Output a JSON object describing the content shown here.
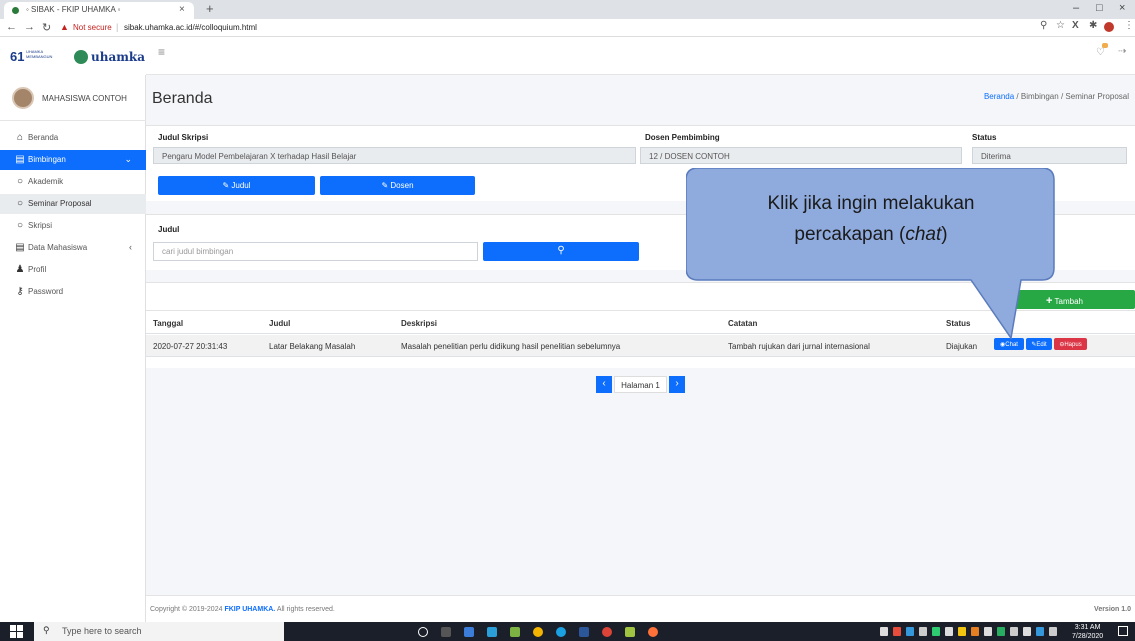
{
  "browser": {
    "tab_title": "◦ SIBAK - FKIP UHAMKA ◦",
    "tab_close": "×",
    "new_tab": "+",
    "not_secure": "Not secure",
    "url": "sibak.uhamka.ac.id/#/colloquium.html"
  },
  "brand": {
    "logo_text": "uhamka",
    "badge_text": "UHAMKA MEMBANGUN"
  },
  "sidebar": {
    "user_name": "MAHASISWA CONTOH",
    "items": [
      {
        "label": "Beranda",
        "icon": "home-icon"
      },
      {
        "label": "Bimbingan",
        "icon": "book-icon",
        "caret": "⌄"
      },
      {
        "label": "Akademik",
        "icon": "circle-icon"
      },
      {
        "label": "Seminar Proposal",
        "icon": "circle-icon"
      },
      {
        "label": "Skripsi",
        "icon": "circle-icon"
      },
      {
        "label": "Data Mahasiswa",
        "icon": "book-icon",
        "caret": "‹"
      },
      {
        "label": "Profil",
        "icon": "user-icon"
      },
      {
        "label": "Password",
        "icon": "key-icon"
      }
    ]
  },
  "page": {
    "title": "Beranda",
    "breadcrumb": [
      "Beranda",
      "Bimbingan",
      "Seminar Proposal"
    ],
    "breadcrumb_sep": "/"
  },
  "info": {
    "judul_label": "Judul Skripsi",
    "judul_value": "Pengaru Model Pembelajaran X terhadap Hasil Belajar",
    "dosen_label": "Dosen Pembimbing",
    "dosen_value": "12 / DOSEN CONTOH",
    "status_label": "Status",
    "status_value": "Diterima",
    "btn_judul": "Judul",
    "btn_dosen": "Dosen"
  },
  "search": {
    "label": "Judul",
    "placeholder": "cari judul bimbingan"
  },
  "table": {
    "add_button": "Tambah",
    "headers": [
      "Tanggal",
      "Judul",
      "Deskripsi",
      "Catatan",
      "Status"
    ],
    "rows": [
      {
        "tanggal": "2020-07-27 20:31:43",
        "judul": "Latar Belakang Masalah",
        "deskripsi": "Masalah penelitian perlu didikung hasil penelitian sebelumnya",
        "catatan": "Tambah rujukan dari jurnal internasional",
        "status": "Diajukan"
      }
    ],
    "actions": {
      "chat": "Chat",
      "edit": "Edit",
      "hapus": "Hapus"
    }
  },
  "pager": {
    "label": "Halaman 1"
  },
  "footer": {
    "copyright_prefix": "Copyright © 2019-2024",
    "org": "FKIP UHAMKA.",
    "suffix": "All rights reserved.",
    "version": "Version 1.0"
  },
  "callout": {
    "line1": "Klik jika ingin melakukan",
    "line2_prefix": "percakapan (",
    "line2_em": "chat",
    "line2_suffix": ")"
  },
  "taskbar": {
    "search_placeholder": "Type here to search",
    "time": "3:31 AM",
    "date": "7/28/2020"
  },
  "colors": {
    "primary": "#0d6efd",
    "success": "#28a745",
    "danger": "#dc3545",
    "callout_fill": "#8faadc"
  }
}
